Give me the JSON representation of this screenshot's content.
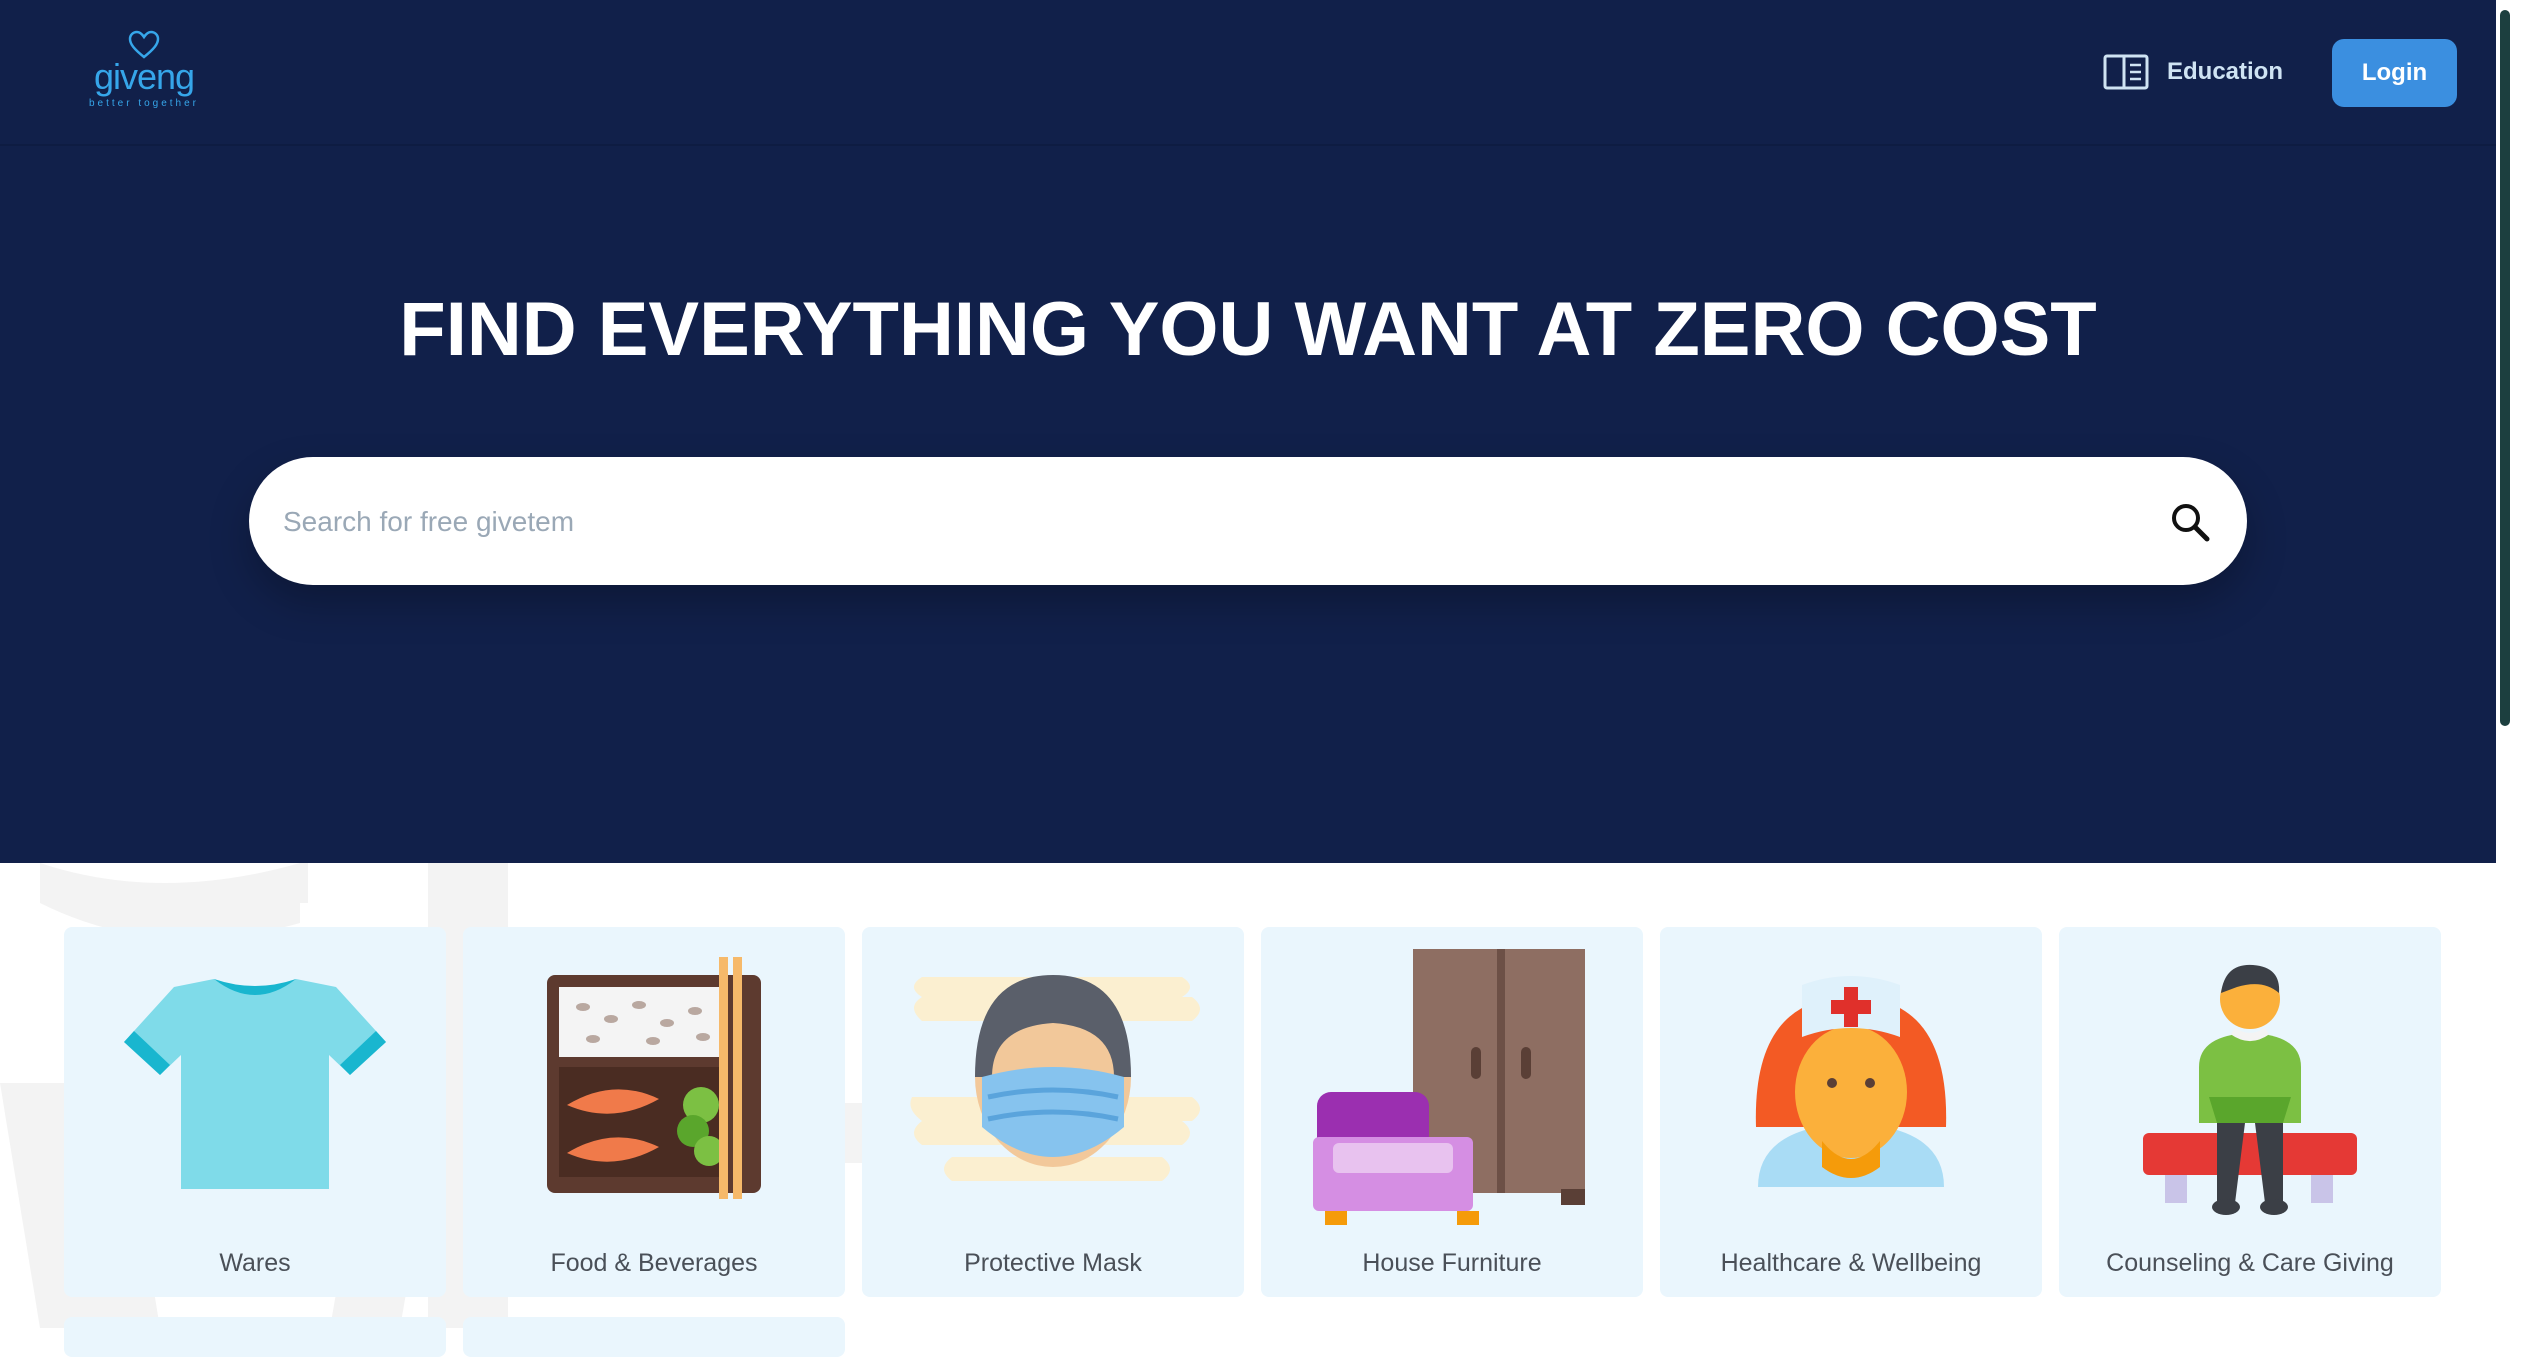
{
  "brand": {
    "name": "giveng",
    "tagline": "better together",
    "colors": {
      "navy": "#11204a",
      "accent": "#3b8fe0",
      "logo": "#36a6ea",
      "card": "#eaf6fd"
    }
  },
  "navbar": {
    "education_label": "Education",
    "education_icon": "book-open-icon",
    "login_label": "Login"
  },
  "hero": {
    "headline": "FIND EVERYTHING YOU WANT AT ZERO COST"
  },
  "search": {
    "placeholder": "Search for free givetem",
    "value": "",
    "icon": "search-icon"
  },
  "categories": [
    {
      "label": "Wares",
      "icon": "tshirt-icon"
    },
    {
      "label": "Food & Beverages",
      "icon": "bento-box-icon"
    },
    {
      "label": "Protective Mask",
      "icon": "face-mask-icon"
    },
    {
      "label": "House Furniture",
      "icon": "furniture-icon"
    },
    {
      "label": "Healthcare & Wellbeing",
      "icon": "nurse-icon"
    },
    {
      "label": "Counseling & Care Giving",
      "icon": "person-sitting-icon"
    }
  ]
}
